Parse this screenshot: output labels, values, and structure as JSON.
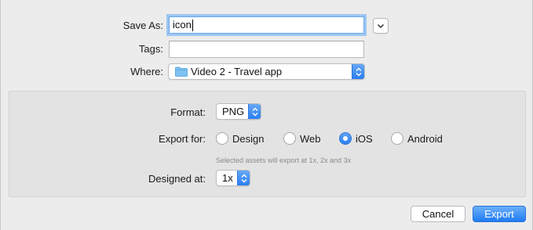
{
  "save_as": {
    "label": "Save As:",
    "value": "icon"
  },
  "tags": {
    "label": "Tags:",
    "value": ""
  },
  "where": {
    "label": "Where:",
    "value": "Video 2 - Travel app"
  },
  "format": {
    "label": "Format:",
    "value": "PNG"
  },
  "export_for": {
    "label": "Export for:",
    "options": [
      "Design",
      "Web",
      "iOS",
      "Android"
    ],
    "selected": "iOS",
    "hint": "Selected assets will export at 1x, 2x and 3x"
  },
  "designed_at": {
    "label": "Designed at:",
    "value": "1x"
  },
  "buttons": {
    "cancel": "Cancel",
    "export": "Export"
  },
  "colors": {
    "accent": "#2a7ff1",
    "focus_ring": "#9cc6f2",
    "panel": "#e3e3e3"
  },
  "icons": [
    "chevron-down-icon",
    "folder-icon",
    "up-down-arrows-icon"
  ]
}
